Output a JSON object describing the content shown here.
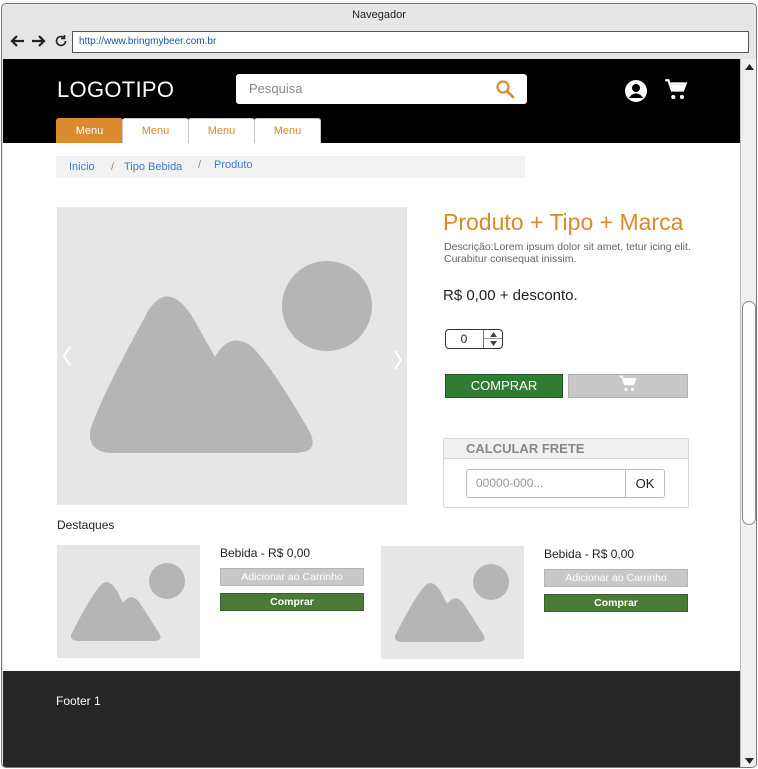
{
  "browser": {
    "title": "Navegador",
    "url": "http://www.bringmybeer.com.br"
  },
  "header": {
    "logo": "LOGOTIPO",
    "search_placeholder": "Pesquisa",
    "icons": [
      "search-icon",
      "user-icon",
      "cart-icon"
    ],
    "background": "#000000"
  },
  "tabs": [
    {
      "label": "Menu",
      "active": true
    },
    {
      "label": "Menu",
      "active": false
    },
    {
      "label": "Menu",
      "active": false
    },
    {
      "label": "Menu",
      "active": false
    }
  ],
  "breadcrumb": {
    "items": [
      "Inicio",
      "Tipo Bebida",
      "Produto"
    ],
    "separator": "/"
  },
  "product": {
    "title": "Produto + Tipo + Marca",
    "description": "Descrição:Lorem ipsum dolor sit amet, tetur icing elit. Curabitur consequat inissim.",
    "price": "R$ 0,00 + desconto.",
    "quantity": "0",
    "buy_label": "COMPRAR",
    "accent_color": "#d98a2b",
    "buy_color": "#2e7d32"
  },
  "frete": {
    "title": "CALCULAR FRETE",
    "placeholder": "00000-000...",
    "ok_label": "OK"
  },
  "destaques": {
    "title": "Destaques",
    "items": [
      {
        "name": "Bebida - R$ 0,00",
        "add_label": "Adicionar ao Carrinho",
        "buy_label": "Comprar"
      },
      {
        "name": "Bebida - R$ 0,00",
        "add_label": "Adicionar ao Carrinho",
        "buy_label": "Comprar"
      }
    ]
  },
  "footer": {
    "text": "Footer 1",
    "background": "#262626"
  }
}
